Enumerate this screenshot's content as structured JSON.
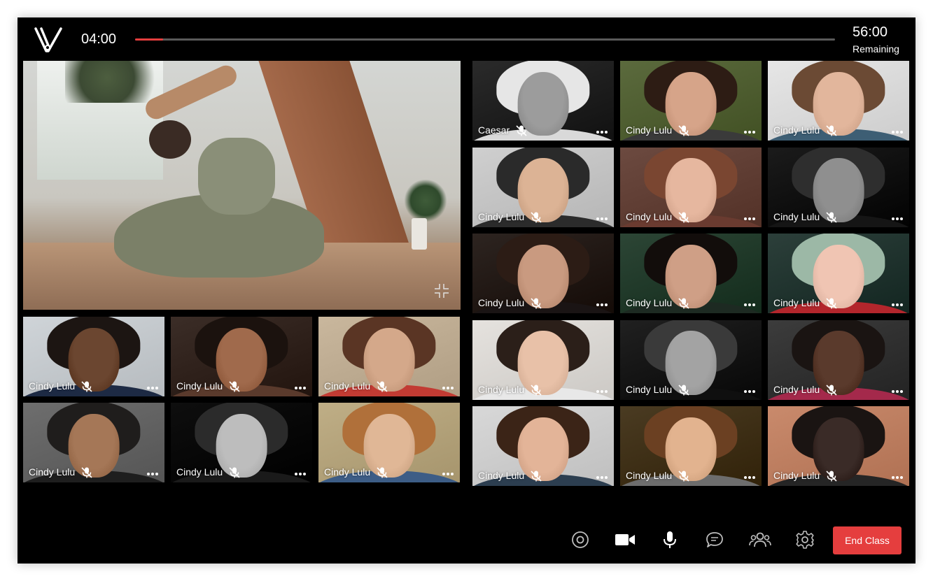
{
  "header": {
    "logo_letter": "V",
    "elapsed": "04:00",
    "remaining_time": "56:00",
    "remaining_label": "Remaining",
    "progress_fraction": 0.04
  },
  "colors": {
    "accent": "#e53e3e",
    "background": "#000000",
    "track": "#5a5a5a"
  },
  "main_video": {
    "collapse_icon": "collapse-icon"
  },
  "left_participants": [
    {
      "name": "Cindy Lulu"
    },
    {
      "name": "Cindy Lulu"
    },
    {
      "name": "Cindy Lulu"
    },
    {
      "name": "Cindy Lulu"
    },
    {
      "name": "Cindy Lulu"
    },
    {
      "name": "Cindy Lulu"
    }
  ],
  "right_participants": [
    {
      "name": "Caesar"
    },
    {
      "name": "Cindy Lulu"
    },
    {
      "name": "Cindy Lulu"
    },
    {
      "name": "Cindy Lulu"
    },
    {
      "name": "Cindy Lulu"
    },
    {
      "name": "Cindy Lulu"
    },
    {
      "name": "Cindy Lulu"
    },
    {
      "name": "Cindy Lulu"
    },
    {
      "name": "Cindy Lulu"
    },
    {
      "name": "Cindy Lulu"
    },
    {
      "name": "Cindy Lulu"
    },
    {
      "name": "Cindy Lulu"
    },
    {
      "name": "Cindy Lulu"
    },
    {
      "name": "Cindy Lulu"
    },
    {
      "name": "Cindy Lulu"
    }
  ],
  "participant_icons": {
    "mute": "mic-off-icon",
    "more": "more-icon"
  },
  "controls": {
    "record_icon": "record-icon",
    "camera_icon": "camera-icon",
    "mic_icon": "mic-icon",
    "chat_icon": "chat-icon",
    "participants_icon": "participants-icon",
    "settings_icon": "settings-icon",
    "end_label": "End Class"
  }
}
